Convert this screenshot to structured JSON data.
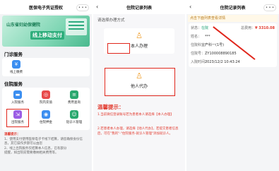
{
  "panel1": {
    "title": "医保电子凭证授权",
    "dots": "• • •",
    "banner": {
      "line1": "山东省妇幼保健院",
      "line2": "线上移动支付"
    },
    "outpatient": {
      "title": "门诊服务",
      "item": "线上缴费"
    },
    "inpatient": {
      "title": "住院服务",
      "items": [
        "入院服务",
        "院内充值",
        "费用查询",
        "出院服务",
        "住院押金",
        "陪诊人管理"
      ]
    },
    "note": {
      "title": "温馨提示：",
      "lines": [
        "1、使用支付使用医保电子卡线下结算，请您确保身份信息，其它操作步骤可以由您",
        "2、线上出院服务仅结算本人信息，已有部分",
        "提醒，如出院前需要缴纳相关费用等。"
      ]
    }
  },
  "panel2": {
    "title": "住院记录列表",
    "choose": "请选择办理方式",
    "opt1": "本人办理",
    "opt2": "他人代办",
    "tip_title": "温馨提示：",
    "tips": [
      "1.当前微信登录账号若为患者本人请选择【本人办理】",
      "2.若患者本人办理，请选择【他人代办】，若提交患者信息后，可在\"我的\"-\"住院服务-就诊人管理\"添加就诊人。"
    ]
  },
  "panel3": {
    "title": "住院记录列表",
    "dots": "• • •",
    "banner": "点击下面列表查看详情",
    "status_k": "状态：",
    "status_v": "在院",
    "amount_k": "总费用：",
    "amount_v": "¥ 3310.08",
    "name_k": "姓名：",
    "name_v": "***",
    "dept_k": "住院科室：",
    "dept_v": "产科一(1号)",
    "no_k": "住院号：",
    "no_v": "ZY100008890185",
    "time_k": "入院时间：",
    "time_v": "2023/12/2 10:43:24"
  },
  "colors": {
    "accent_red": "#e0261c",
    "green": "#1aa073",
    "orange": "#f0a030"
  }
}
